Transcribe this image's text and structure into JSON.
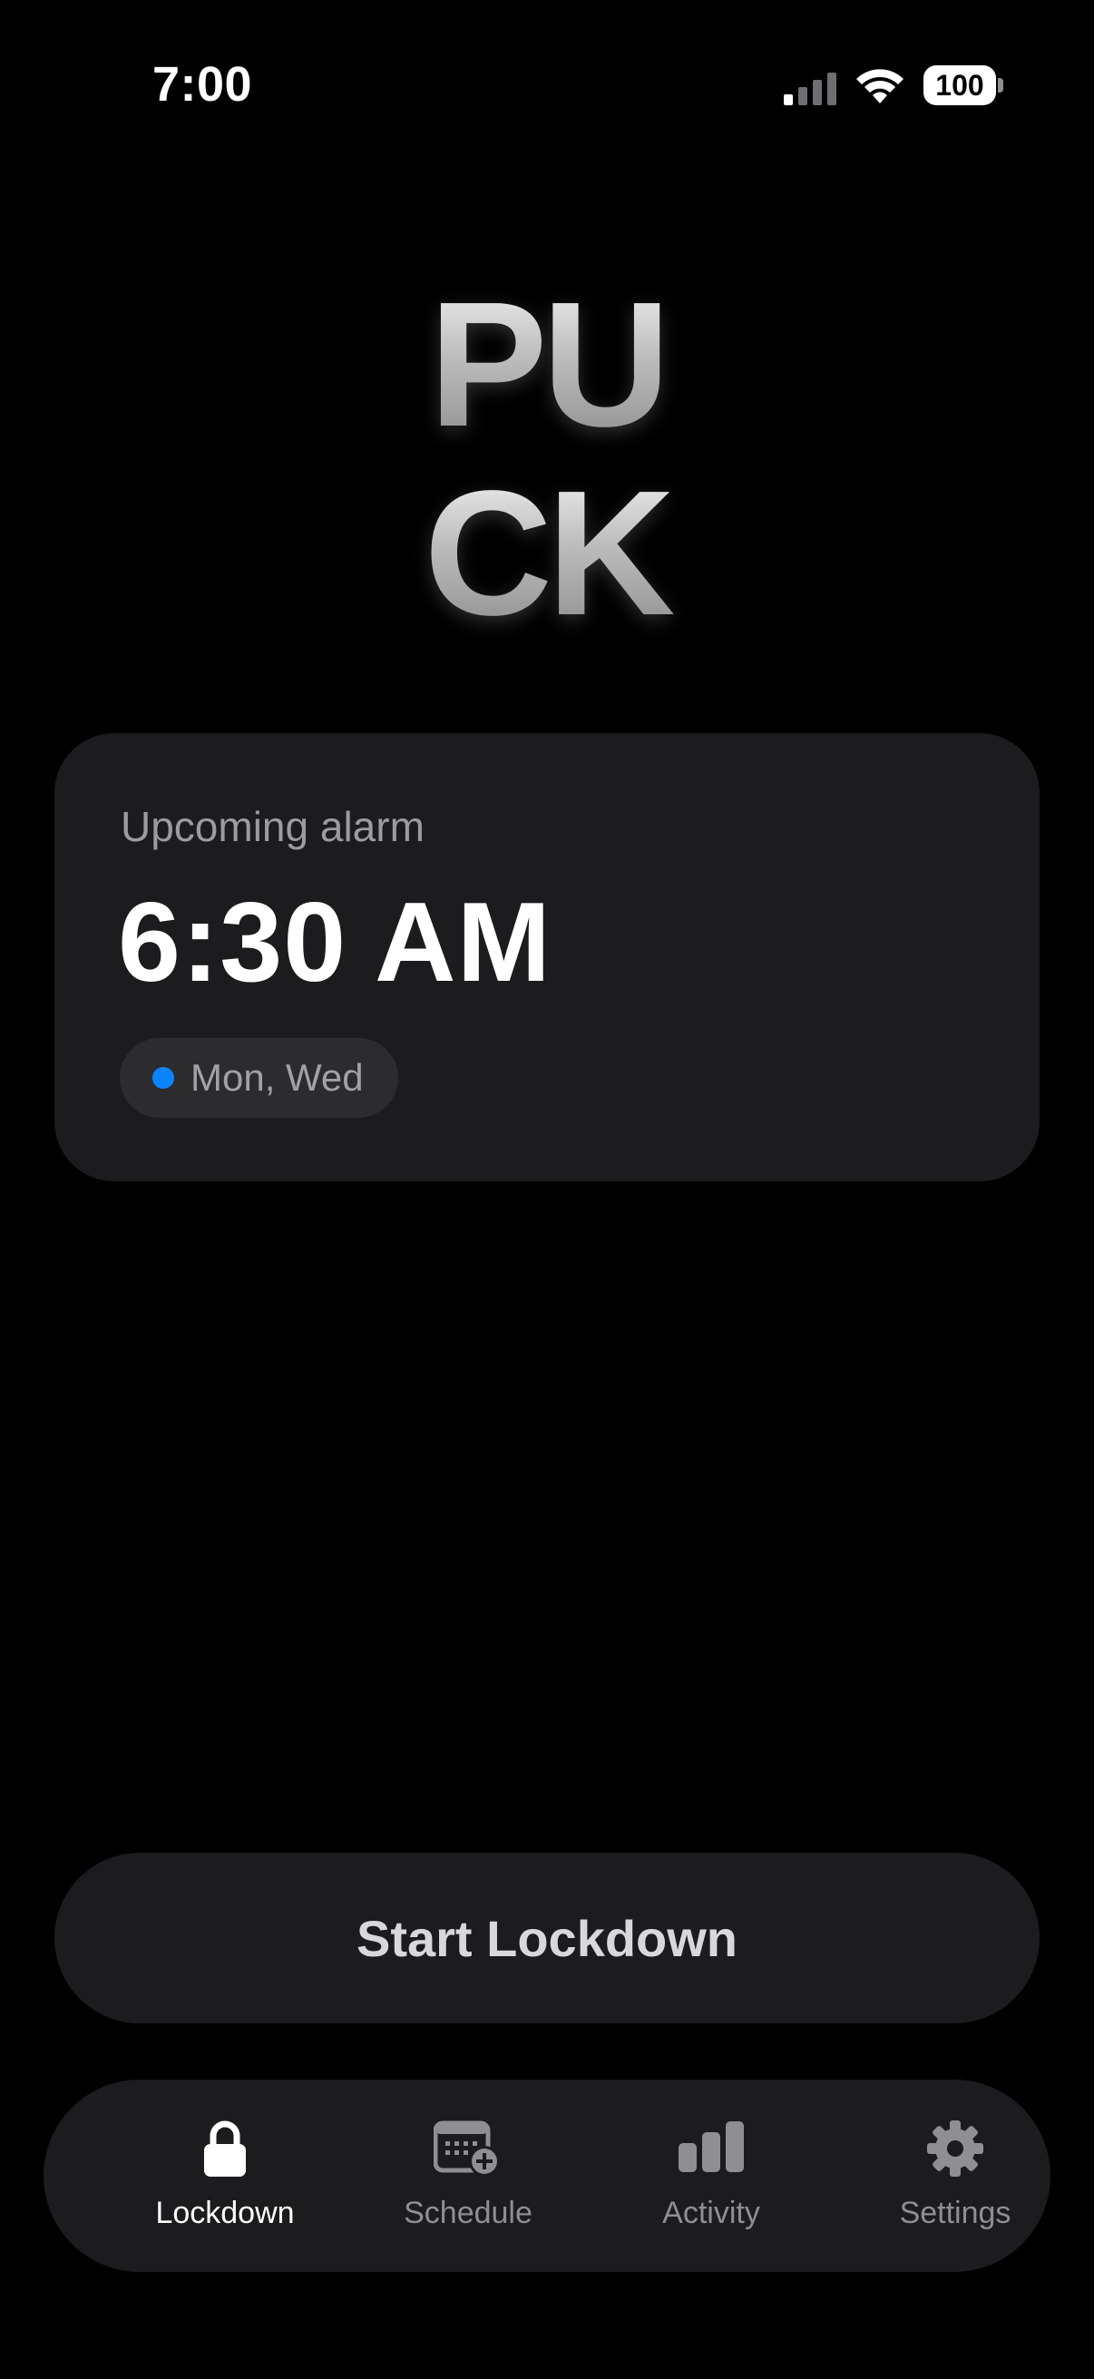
{
  "status_bar": {
    "time": "7:00",
    "battery": "100",
    "signal_icon": "cellular-signal-icon",
    "wifi_icon": "wifi-icon"
  },
  "logo": {
    "line1": "PU",
    "line2": "CK"
  },
  "alarm_card": {
    "label": "Upcoming alarm",
    "time": "6:30 AM",
    "days": "Mon, Wed",
    "dot_color": "#0a84ff"
  },
  "primary_action": {
    "label": "Start Lockdown"
  },
  "tab_bar": {
    "active": "Lockdown",
    "tabs": [
      {
        "label": "Lockdown",
        "icon": "lock-icon"
      },
      {
        "label": "Schedule",
        "icon": "calendar-add-icon"
      },
      {
        "label": "Activity",
        "icon": "bar-chart-icon"
      },
      {
        "label": "Settings",
        "icon": "gear-icon"
      }
    ]
  },
  "colors": {
    "background": "#000000",
    "card": "#1c1c1e",
    "accent_blue": "#0a84ff",
    "inactive_tab": "#8e8e93"
  }
}
